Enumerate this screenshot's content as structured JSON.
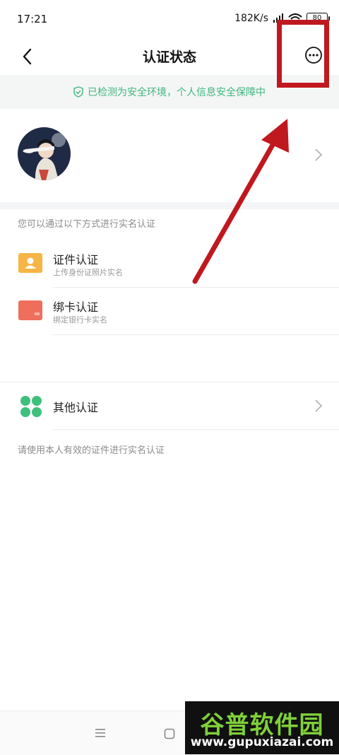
{
  "status_bar": {
    "time": "17:21",
    "network_speed": "182K/s",
    "battery": "80"
  },
  "header": {
    "title": "认证状态"
  },
  "banner": {
    "text": "已检测为安全环境，个人信息安全保障中"
  },
  "section": {
    "hint": "您可以通过以下方式进行实名认证"
  },
  "methods": [
    {
      "title": "证件认证",
      "subtitle": "上传身份证照片实名",
      "icon": "id-card-icon",
      "color": "#f7b545"
    },
    {
      "title": "绑卡认证",
      "subtitle": "绑定银行卡实名",
      "icon": "bank-card-icon",
      "color": "#ef6e5c"
    }
  ],
  "other": {
    "title": "其他认证",
    "icon": "grid-dots-icon",
    "color": "#3ec07c"
  },
  "bottom_hint": "请使用本人有效的证件进行实名认证",
  "watermark": {
    "brand": "谷普软件园",
    "url": "www.gupuxiazai.com"
  },
  "colors": {
    "accent_green": "#41b67f",
    "annotation_red": "#c0181f"
  }
}
